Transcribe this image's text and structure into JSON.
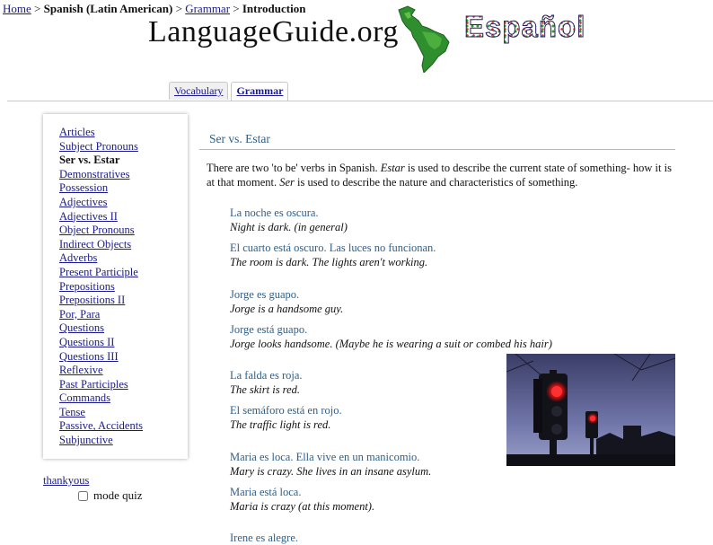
{
  "breadcrumb": {
    "home": "Home",
    "sep1": " > ",
    "language": "Spanish (Latin American)",
    "sep2": " > ",
    "grammar": "Grammar",
    "sep3": " > ",
    "current": "Introduction"
  },
  "logo": {
    "site": "LanguageGuide.org",
    "language_word": "Español",
    "map_icon": "latin-america-map-icon"
  },
  "tabs": [
    {
      "label": "Vocabulary",
      "active": false
    },
    {
      "label": "Grammar",
      "active": true
    }
  ],
  "sidebar": {
    "items": [
      {
        "label": "Articles"
      },
      {
        "label": "Subject Pronouns"
      },
      {
        "label": "Ser vs. Estar",
        "current": true
      },
      {
        "label": "Demonstratives"
      },
      {
        "label": "Possession"
      },
      {
        "label": "Adjectives"
      },
      {
        "label": "Adjectives II"
      },
      {
        "label": "Object Pronouns"
      },
      {
        "label": "Indirect Objects"
      },
      {
        "label": "Adverbs"
      },
      {
        "label": "Present Participle"
      },
      {
        "label": "Prepositions"
      },
      {
        "label": "Prepositions II"
      },
      {
        "label": "Por, Para"
      },
      {
        "label": "Questions"
      },
      {
        "label": "Questions II"
      },
      {
        "label": "Questions III"
      },
      {
        "label": "Reflexive"
      },
      {
        "label": "Past Participles"
      },
      {
        "label": "Commands"
      },
      {
        "label": "Tense"
      },
      {
        "label": "Passive, Accidents"
      },
      {
        "label": "Subjunctive"
      }
    ]
  },
  "footer_links": {
    "thankyous": "thankyous",
    "quiz_label": "mode quiz",
    "quiz_checked": false
  },
  "main": {
    "title": "Ser vs. Estar",
    "intro": {
      "p1": "There are two 'to be' verbs in Spanish. ",
      "estar": "Estar",
      "p2": " is used to describe the current state of something- how it is at that moment. ",
      "ser": "Ser",
      "p3": " is used to describe the nature and characteristics of something."
    },
    "examples": [
      {
        "es": "La noche es oscura.",
        "en": "Night is dark. (in general)"
      },
      {
        "es": "El cuarto está oscuro. Las luces no funcionan.",
        "en": "The room is dark. The lights aren't working."
      },
      {
        "es": "Jorge es guapo.",
        "en": "Jorge is a handsome guy."
      },
      {
        "es": "Jorge está guapo.",
        "en": "Jorge looks handsome. (Maybe he is wearing a suit or combed his hair)"
      },
      {
        "es": "La falda es roja.",
        "en": "The skirt is red."
      },
      {
        "es": "El semáforo está en rojo.",
        "en": "The traffic light is red."
      },
      {
        "es": "Maria es loca. Ella vive en un manicomio.",
        "en": "Mary is crazy. She lives in an insane asylum."
      },
      {
        "es": "Maria está loca.",
        "en": "Maria is crazy (at this moment)."
      },
      {
        "es": "Irene es alegre.",
        "en": ""
      }
    ],
    "photo": "traffic-light-photo"
  },
  "colors": {
    "link": "#1a1a8c",
    "spanish_text": "#2e5f8a",
    "tab_border": "#c8c8c8"
  }
}
